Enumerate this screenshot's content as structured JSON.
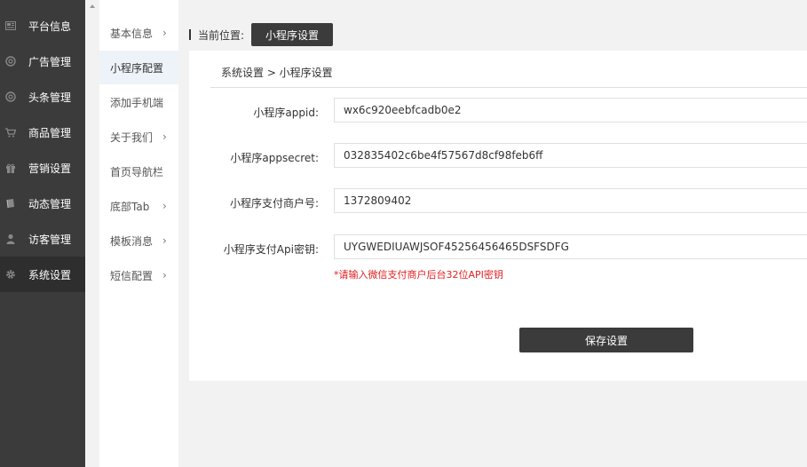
{
  "sidebar": {
    "items": [
      {
        "label": "平台信息",
        "icon": "newspaper-icon",
        "active": false
      },
      {
        "label": "广告管理",
        "icon": "globe-icon",
        "active": false
      },
      {
        "label": "头条管理",
        "icon": "globe-icon",
        "active": false
      },
      {
        "label": "商品管理",
        "icon": "cart-icon",
        "active": false
      },
      {
        "label": "营销设置",
        "icon": "gift-icon",
        "active": false
      },
      {
        "label": "动态管理",
        "icon": "book-icon",
        "active": false
      },
      {
        "label": "访客管理",
        "icon": "user-icon",
        "active": false
      },
      {
        "label": "系统设置",
        "icon": "gear-icon",
        "active": true
      }
    ]
  },
  "submenu": {
    "items": [
      {
        "label": "基本信息",
        "chevron": "›"
      },
      {
        "label": "小程序配置",
        "chevron": ""
      },
      {
        "label": "添加手机端",
        "chevron": ""
      },
      {
        "label": "关于我们",
        "chevron": "›"
      },
      {
        "label": "首页导航栏",
        "chevron": ""
      },
      {
        "label": "底部Tab",
        "chevron": "›"
      },
      {
        "label": "模板消息",
        "chevron": "›"
      },
      {
        "label": "短信配置",
        "chevron": "›"
      }
    ]
  },
  "breadcrumb": {
    "prefix": "当前位置:",
    "current": "小程序设置"
  },
  "panel": {
    "path": "系统设置 > 小程序设置"
  },
  "form": {
    "appid_label": "小程序appid:",
    "appid_value": "wx6c920eebfcadb0e2",
    "appsecret_label": "小程序appsecret:",
    "appsecret_value": "032835402c6be4f57567d8cf98feb6ff",
    "mchid_label": "小程序支付商户号:",
    "mchid_value": "1372809402",
    "apikey_label": "小程序支付Api密钥:",
    "apikey_value": "UYGWEDIUAWJSOF45256456465DSFSDFG",
    "apikey_hint": "*请输入微信支付商户后台32位API密钥",
    "save_label": "保存设置"
  },
  "colors": {
    "sidebar_bg": "#3b3b3b",
    "button_bg": "#3b3b3b",
    "hint_red": "#e02020"
  }
}
